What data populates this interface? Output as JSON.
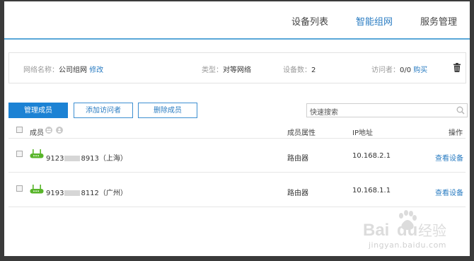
{
  "nav": {
    "items": [
      {
        "label": "设备列表",
        "active": false
      },
      {
        "label": "智能组网",
        "active": true
      },
      {
        "label": "服务管理",
        "active": false
      }
    ]
  },
  "info": {
    "network_name_label": "网络名称：",
    "network_name_value": "公司组网",
    "edit_link": "修改",
    "type_label": "类型：",
    "type_value": "对等网络",
    "device_count_label": "设备数：",
    "device_count_value": "2",
    "visitor_label": "访问者：",
    "visitor_value": "0/0",
    "buy_link": "购买"
  },
  "toolbar": {
    "manage_members": "管理成员",
    "add_visitor": "添加访问者",
    "delete_member": "删除成员",
    "search_placeholder": "快速搜索"
  },
  "table": {
    "headers": {
      "member": "成员",
      "attribute": "成员属性",
      "ip": "IP地址",
      "action": "操作"
    },
    "rows": [
      {
        "id_prefix": "9123",
        "id_suffix": "8913（上海）",
        "attribute": "路由器",
        "ip": "10.168.2.1",
        "action": "查看设备"
      },
      {
        "id_prefix": "9193",
        "id_suffix": "8112（广州）",
        "attribute": "路由器",
        "ip": "10.168.1.1",
        "action": "查看设备"
      }
    ]
  },
  "watermark": {
    "url": "jingyan.baidu.com"
  },
  "colors": {
    "accent": "#2a7cc2",
    "primary_button": "#1c82d4",
    "router_green": "#58b52a",
    "background": "#3a3a3a"
  }
}
